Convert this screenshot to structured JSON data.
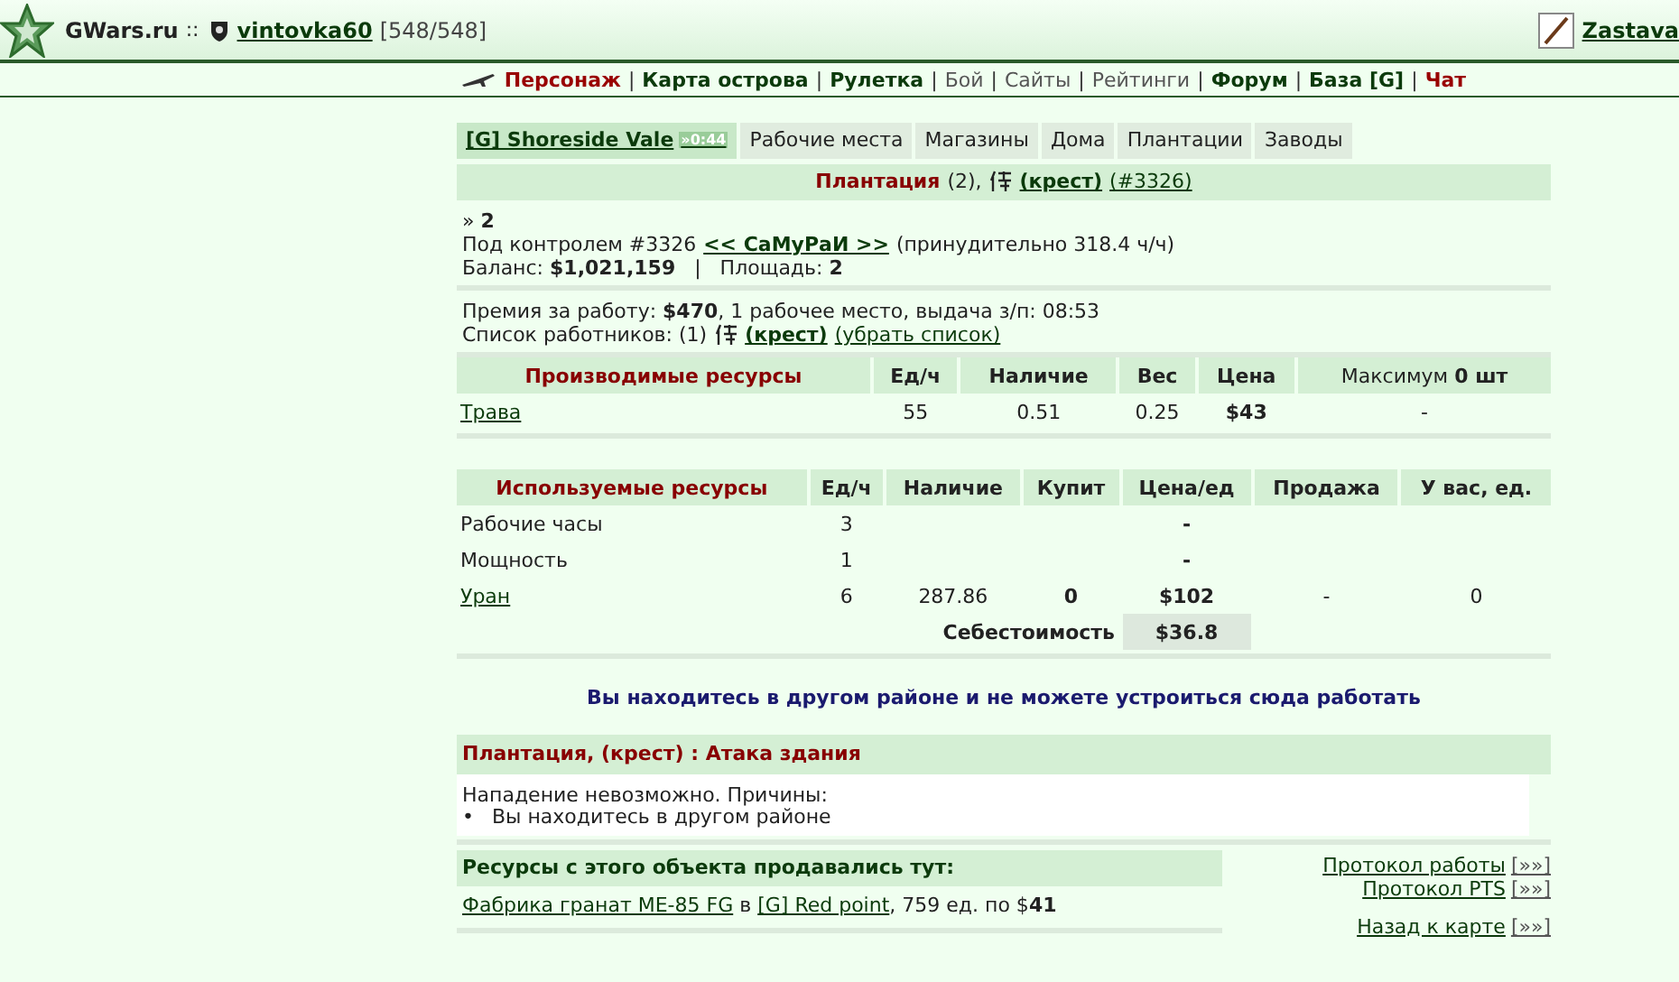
{
  "header": {
    "site": "GWars.ru",
    "sep": "::",
    "user": "vintovka60",
    "hp": "[548/548]",
    "right_user": "Zastava"
  },
  "nav": [
    {
      "label": "Персонаж",
      "kind": "red"
    },
    {
      "label": "|",
      "kind": "sep"
    },
    {
      "label": "Карта острова",
      "kind": "bold"
    },
    {
      "label": "|",
      "kind": "sep"
    },
    {
      "label": "Рулетка",
      "kind": "bold"
    },
    {
      "label": "|",
      "kind": "sep"
    },
    {
      "label": "Бой",
      "kind": "plain"
    },
    {
      "label": "|",
      "kind": "sep"
    },
    {
      "label": "Сайты",
      "kind": "plain"
    },
    {
      "label": "|",
      "kind": "sep"
    },
    {
      "label": "Рейтинги",
      "kind": "plain"
    },
    {
      "label": "|",
      "kind": "sep"
    },
    {
      "label": "Форум",
      "kind": "bold"
    },
    {
      "label": "|",
      "kind": "sep"
    },
    {
      "label": "База [G]",
      "kind": "bold"
    },
    {
      "label": "|",
      "kind": "sep"
    },
    {
      "label": "Чат",
      "kind": "red"
    }
  ],
  "tabs": [
    {
      "label": "[G] Shoreside Vale",
      "badge": "»0:44",
      "selected": true
    },
    {
      "label": "Рабочие места",
      "selected": false
    },
    {
      "label": "Магазины",
      "selected": false
    },
    {
      "label": "Дома",
      "selected": false
    },
    {
      "label": "Плантации",
      "selected": false
    },
    {
      "label": "Заводы",
      "selected": false
    }
  ],
  "title": {
    "name": "Плантация",
    "count": "(2),",
    "owner": "(крест)",
    "id": "(#3326)"
  },
  "info": {
    "level": "» **2**",
    "control": "Под контролем #3326",
    "controller": "<< СаМуРаИ >>",
    "forced": "(принудительно 318.4 ч/ч)",
    "balance": "Баланс: **$1,021,159**   |   Площадь: **2**"
  },
  "work": {
    "premium": "Премия за работу: **$470**, 1 рабочее место, выдача з/п: 08:53",
    "workers": "Список работников: (1)",
    "worker": "(крест)",
    "clear": "(убрать список)"
  },
  "produced": {
    "columns": [
      "Производимые ресурсы",
      "Ед/ч",
      "Наличие",
      "Вес",
      "Цена",
      "Максимум **0 шт**"
    ],
    "rows": [
      {
        "cells": [
          "Трава",
          "55",
          "0.51",
          "0.25",
          "$43",
          "-"
        ]
      }
    ]
  },
  "used": {
    "columns": [
      "Используемые ресурсы",
      "Ед/ч",
      "Наличие",
      "Купит",
      "Цена/ед",
      "Продажа",
      "У вас, ед."
    ],
    "rows": [
      {
        "link": false,
        "cells": [
          "Рабочие часы",
          "3",
          "",
          "",
          "-",
          "",
          ""
        ]
      },
      {
        "link": false,
        "cells": [
          "Мощность",
          "1",
          "",
          "",
          "-",
          "",
          ""
        ]
      },
      {
        "link": true,
        "cells": [
          "Уран",
          "6",
          "287.86",
          "0",
          "$102",
          "-",
          "0"
        ]
      }
    ],
    "cost_label": "Себестоимость",
    "cost_value": "$36.8"
  },
  "notice": "Вы находитесь в другом районе и не можете устроиться сюда работать",
  "attack": {
    "title": "Плантация, (крест) : Атака здания",
    "text": "Нападение невозможно. Причины:",
    "reasons": [
      {
        "bullet": "•",
        "text": "Вы находитесь в другом районе"
      }
    ]
  },
  "sales": {
    "title": "Ресурсы с этого объекта продавались тут:",
    "entries": [
      {
        "factory": "Фабрика гранат ME-85 FG",
        "in": "в",
        "place": "[G] Red point",
        "rest": ", 759 ед. по $**41**"
      }
    ]
  },
  "links": [
    {
      "label": "Протокол работы",
      "arrow": "[»»]"
    },
    {
      "label": "Протокол PTS",
      "arrow": "[»»]"
    },
    {
      "label": "Назад к карте",
      "arrow": "[»»]"
    }
  ]
}
